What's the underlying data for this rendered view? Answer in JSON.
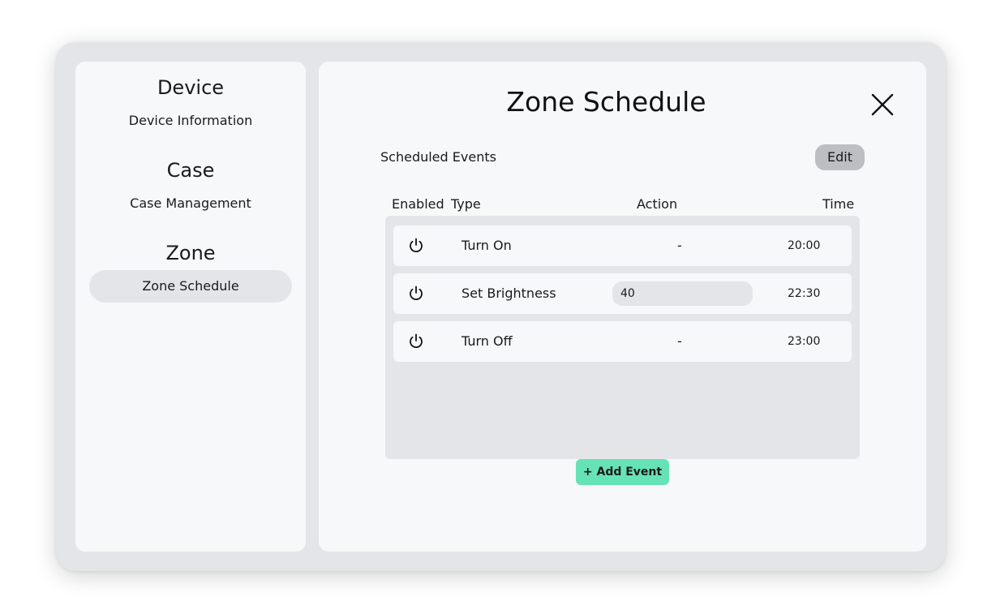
{
  "sidebar": {
    "sections": [
      {
        "heading": "Device",
        "item": "Device Information"
      },
      {
        "heading": "Case",
        "item": "Case Management"
      },
      {
        "heading": "Zone",
        "item": "Zone Schedule"
      }
    ]
  },
  "main": {
    "title": "Zone Schedule",
    "section_label": "Scheduled Events",
    "edit_label": "Edit",
    "columns": [
      "Enabled",
      "Type",
      "Action",
      "Time"
    ],
    "rows": [
      {
        "type": "Turn On",
        "action": "-",
        "time": "20:00"
      },
      {
        "type": "Set Brightness",
        "action": "40",
        "time": "22:30"
      },
      {
        "type": "Turn Off",
        "action": "-",
        "time": "23:00"
      }
    ],
    "add_label": "+ Add Event"
  },
  "colors": {
    "frame": "#e4e5e8",
    "panel": "#f7f8fa",
    "edit_button": "#bdbec1",
    "add_button": "#66e3b6"
  },
  "icons": [
    "power-icon",
    "close-icon"
  ]
}
